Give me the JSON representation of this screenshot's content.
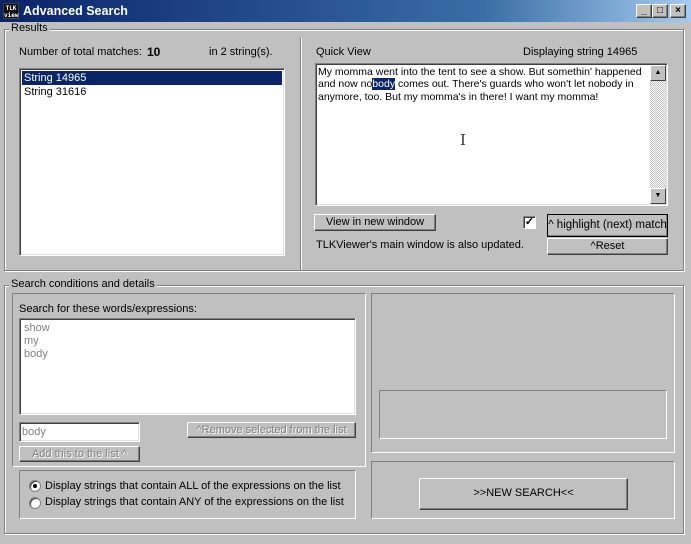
{
  "window": {
    "title": "Advanced Search",
    "icon_text_line1": "TLK",
    "icon_text_line2": "view",
    "controls": {
      "minimize": "_",
      "maximize": "□",
      "close": "×"
    }
  },
  "results": {
    "legend": "Results",
    "matches_label": "Number of total matches:",
    "matches_count": "10",
    "strings_text": "in 2 string(s).",
    "list": [
      "String 14965",
      "String 31616"
    ],
    "selected_index": 0
  },
  "quickview": {
    "label": "Quick View",
    "displaying": "Displaying string 14965",
    "text_before": "My momma went into the tent to see a show.  But somethin' happened and now no",
    "text_highlight": "body",
    "text_after": " comes out.  There's guards who won't let nobody in anymore, too.  But my momma's in there!  I want my momma!",
    "view_button": "View in new window",
    "checkbox_checked": true,
    "checkbox_mark": "✓",
    "highlight_button": "^ highlight (next) match",
    "reset_button": "^Reset",
    "status": "TLKViewer's main window is also updated."
  },
  "search": {
    "legend": "Search conditions and details",
    "words_label": "Search for these words/expressions:",
    "words": [
      "show",
      "my",
      "body"
    ],
    "input_value": "body",
    "remove_button": "^Remove selected from the list",
    "add_button": "Add this to the list ^",
    "radio_all": "Display strings that contain ALL of the expressions on the list",
    "radio_any": "Display strings that contain ANY of the expressions on the list",
    "radio_selected": "all",
    "new_search_button": ">>NEW SEARCH<<"
  }
}
